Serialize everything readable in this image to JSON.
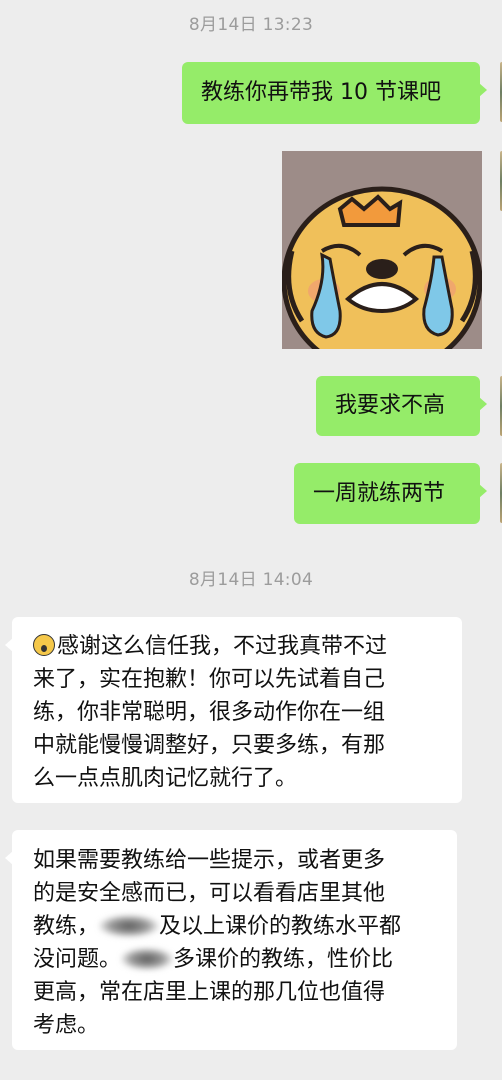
{
  "chat": {
    "timestamp1": "8月14日 13:23",
    "timestamp2": "8月14日 14:04",
    "out_messages": [
      "教练你再带我 10 节课吧",
      "我要求不高",
      "一周就练两节"
    ],
    "sticker_name": "crying-bear-sticker",
    "in_message1": {
      "emoji": "face-with-open-mouth-emoji",
      "lines": [
        "感谢这么信任我，不过我真带不过",
        "来了，实在抱歉！你可以先试着自己",
        "练，你非常聪明，很多动作你在一组",
        "中就能慢慢调整好，只要多练，有那",
        "么一点点肌肉记忆就行了。"
      ]
    },
    "in_message2": {
      "line1": "如果需要教练给一些提示，或者更多",
      "line2": "的是安全感而已，可以看看店里其他",
      "line3a": "教练，",
      "line3b": "及以上课价的教练水平都",
      "line4a": "没问题。",
      "line4b": "多课价的教练，性价比",
      "line5": "更高，常在店里上课的那几位也值得",
      "line6": "考虑。"
    }
  },
  "colors": {
    "background": "#ededed",
    "outgoing_bubble": "#95ec69",
    "incoming_bubble": "#ffffff",
    "timestamp": "#9c9c9c"
  }
}
